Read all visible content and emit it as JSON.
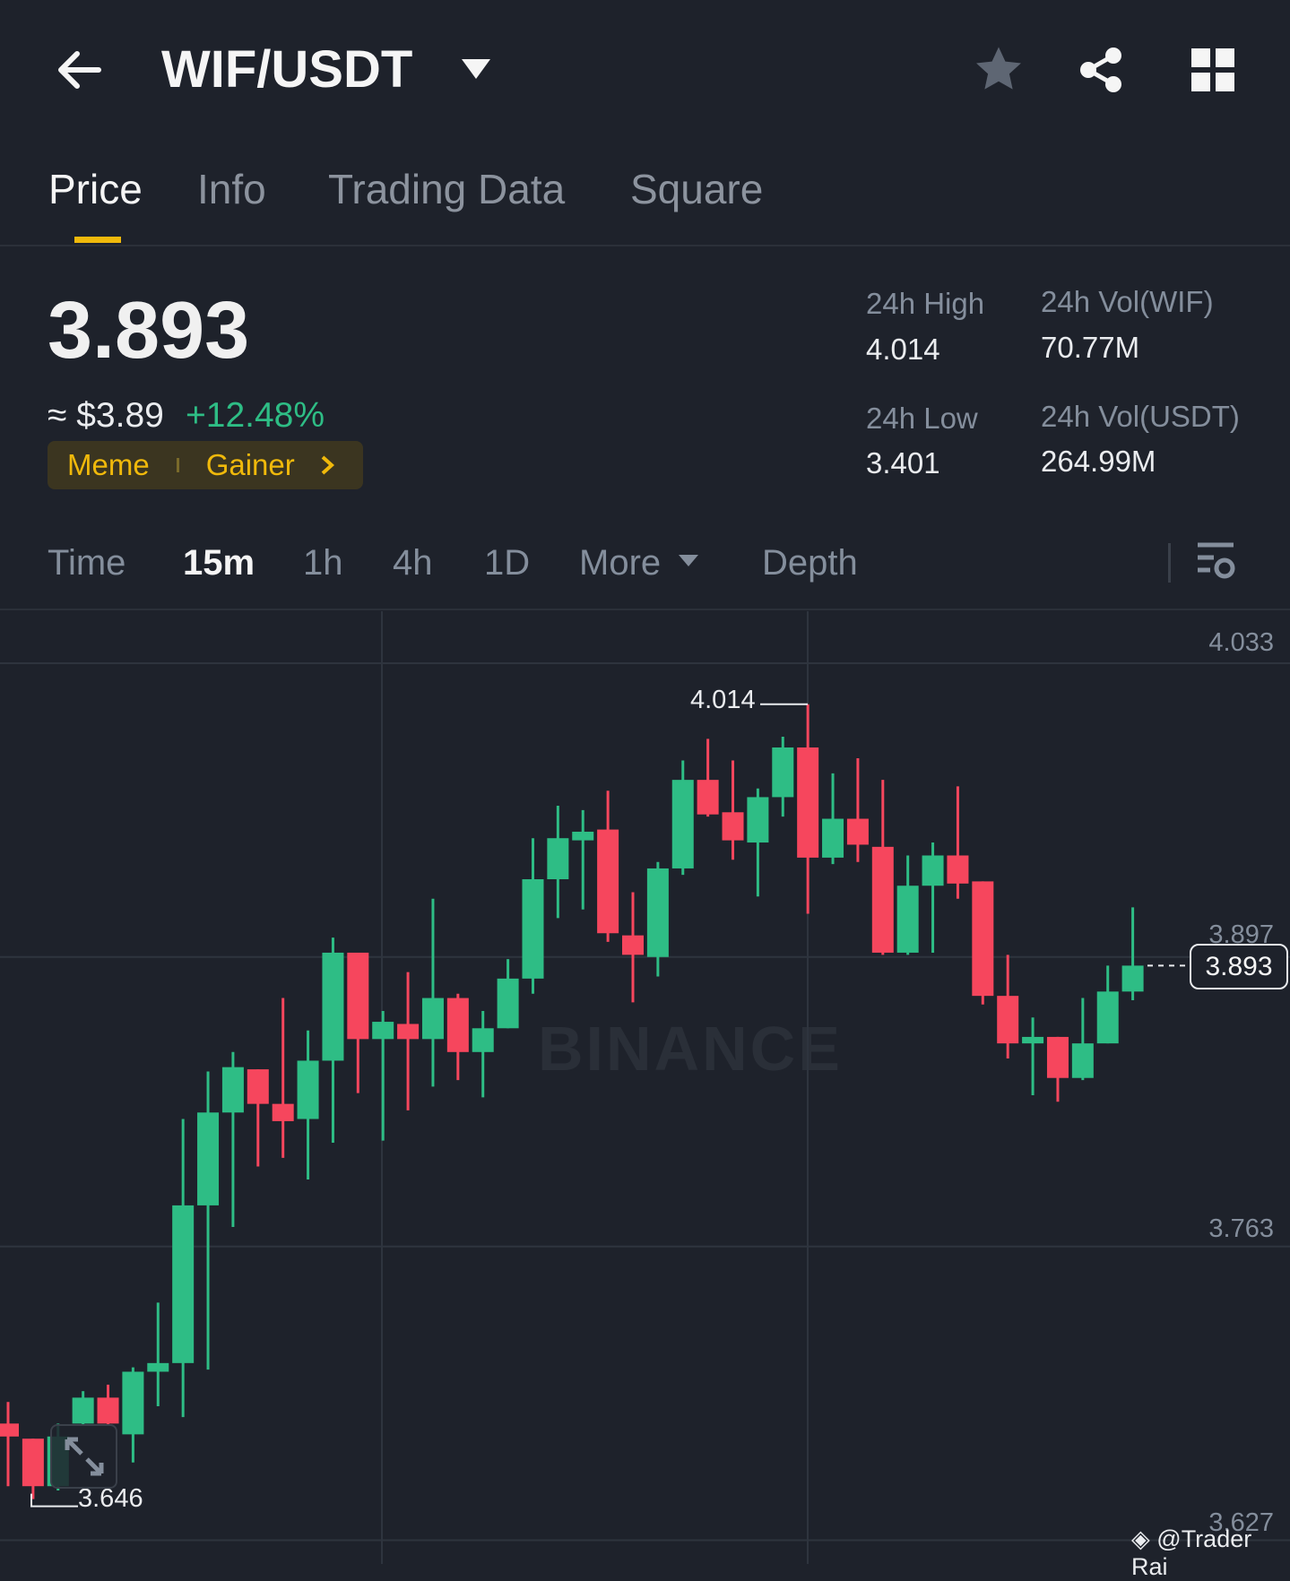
{
  "header": {
    "title": "WIF/USDT"
  },
  "tabs": [
    {
      "label": "Price"
    },
    {
      "label": "Info"
    },
    {
      "label": "Trading Data"
    },
    {
      "label": "Square"
    }
  ],
  "ticker": {
    "last_price": "3.893",
    "usd_price": "≈ $3.89",
    "change": "+12.48%",
    "tags": [
      "Meme",
      "Gainer"
    ]
  },
  "stats": {
    "high_label": "24h High",
    "high_value": "4.014",
    "low_label": "24h Low",
    "low_value": "3.401",
    "vol_base_label": "24h Vol(WIF)",
    "vol_base_value": "70.77M",
    "vol_quote_label": "24h Vol(USDT)",
    "vol_quote_value": "264.99M"
  },
  "intervals": [
    {
      "label": "Time"
    },
    {
      "label": "15m"
    },
    {
      "label": "1h"
    },
    {
      "label": "4h"
    },
    {
      "label": "1D"
    },
    {
      "label": "More"
    },
    {
      "label": "Depth"
    }
  ],
  "watermark": "BINANCE",
  "credit": "@Trader Rai",
  "colors": {
    "up": "#2ebd85",
    "down": "#f6465d",
    "accent": "#f0b90b"
  },
  "chart_data": {
    "type": "candlestick",
    "interval": "15m",
    "y_ticks": [
      "4.033",
      "3.897",
      "3.763",
      "3.627"
    ],
    "ylim": [
      3.627,
      4.033
    ],
    "current_price_label": "3.893",
    "high_marker": "4.014",
    "low_marker": "3.646",
    "candles": [
      [
        3.681,
        3.691,
        3.652,
        3.675
      ],
      [
        3.674,
        3.674,
        3.646,
        3.652
      ],
      [
        3.652,
        3.681,
        3.65,
        3.675
      ],
      [
        3.681,
        3.696,
        3.68,
        3.693
      ],
      [
        3.693,
        3.699,
        3.68,
        3.681
      ],
      [
        3.676,
        3.707,
        3.663,
        3.705
      ],
      [
        3.705,
        3.737,
        3.689,
        3.709
      ],
      [
        3.709,
        3.822,
        3.684,
        3.782
      ],
      [
        3.782,
        3.844,
        3.706,
        3.825
      ],
      [
        3.825,
        3.853,
        3.772,
        3.846
      ],
      [
        3.845,
        3.845,
        3.8,
        3.829
      ],
      [
        3.829,
        3.878,
        3.804,
        3.821
      ],
      [
        3.822,
        3.863,
        3.794,
        3.849
      ],
      [
        3.849,
        3.906,
        3.811,
        3.899
      ],
      [
        3.899,
        3.899,
        3.834,
        3.859
      ],
      [
        3.859,
        3.872,
        3.812,
        3.867
      ],
      [
        3.866,
        3.89,
        3.826,
        3.859
      ],
      [
        3.859,
        3.924,
        3.837,
        3.878
      ],
      [
        3.878,
        3.88,
        3.84,
        3.853
      ],
      [
        3.853,
        3.872,
        3.832,
        3.864
      ],
      [
        3.864,
        3.896,
        3.864,
        3.887
      ],
      [
        3.887,
        3.952,
        3.88,
        3.933
      ],
      [
        3.933,
        3.967,
        3.915,
        3.952
      ],
      [
        3.951,
        3.965,
        3.919,
        3.955
      ],
      [
        3.956,
        3.974,
        3.904,
        3.908
      ],
      [
        3.907,
        3.927,
        3.876,
        3.898
      ],
      [
        3.897,
        3.941,
        3.888,
        3.938
      ],
      [
        3.938,
        3.988,
        3.935,
        3.979
      ],
      [
        3.979,
        3.998,
        3.962,
        3.963
      ],
      [
        3.964,
        3.988,
        3.942,
        3.951
      ],
      [
        3.95,
        3.975,
        3.925,
        3.971
      ],
      [
        3.971,
        3.999,
        3.962,
        3.994
      ],
      [
        3.994,
        4.014,
        3.917,
        3.943
      ],
      [
        3.943,
        3.982,
        3.94,
        3.961
      ],
      [
        3.961,
        3.989,
        3.941,
        3.949
      ],
      [
        3.948,
        3.979,
        3.898,
        3.899
      ],
      [
        3.899,
        3.944,
        3.898,
        3.93
      ],
      [
        3.93,
        3.95,
        3.899,
        3.944
      ],
      [
        3.944,
        3.976,
        3.924,
        3.931
      ],
      [
        3.932,
        3.932,
        3.875,
        3.879
      ],
      [
        3.879,
        3.898,
        3.85,
        3.857
      ],
      [
        3.857,
        3.869,
        3.833,
        3.86
      ],
      [
        3.86,
        3.86,
        3.83,
        3.841
      ],
      [
        3.841,
        3.878,
        3.84,
        3.857
      ],
      [
        3.857,
        3.893,
        3.857,
        3.881
      ],
      [
        3.881,
        3.92,
        3.877,
        3.893
      ]
    ]
  }
}
